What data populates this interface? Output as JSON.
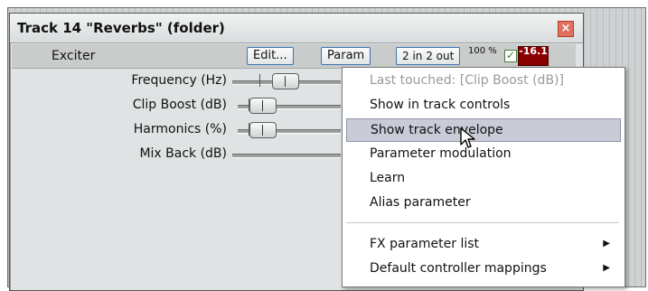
{
  "window": {
    "title": "Track 14 \"Reverbs\" (folder)",
    "close_label": "×"
  },
  "fx": {
    "name": "Exciter",
    "edit_label": "Edit...",
    "param_label": "Param",
    "io_label": "2 in 2 out",
    "wet_percent": "100 %",
    "checkbox_mark": "✓",
    "meter_value": "-16.1"
  },
  "params": [
    {
      "label": "Frequency (Hz)"
    },
    {
      "label": "Clip Boost (dB)"
    },
    {
      "label": "Harmonics (%)"
    },
    {
      "label": "Mix Back (dB)"
    }
  ],
  "menu": {
    "items": [
      {
        "label": "Last touched: [Clip Boost (dB)]",
        "disabled": true
      },
      {
        "label": "Show in track controls"
      },
      {
        "label": "Show track envelope",
        "highlighted": true
      },
      {
        "label": "Parameter modulation"
      },
      {
        "label": "Learn"
      },
      {
        "label": "Alias parameter"
      },
      {
        "label": "FX parameter list",
        "submenu": true
      },
      {
        "label": "Default controller mappings",
        "submenu": true
      }
    ],
    "submenu_arrow": "▶"
  }
}
